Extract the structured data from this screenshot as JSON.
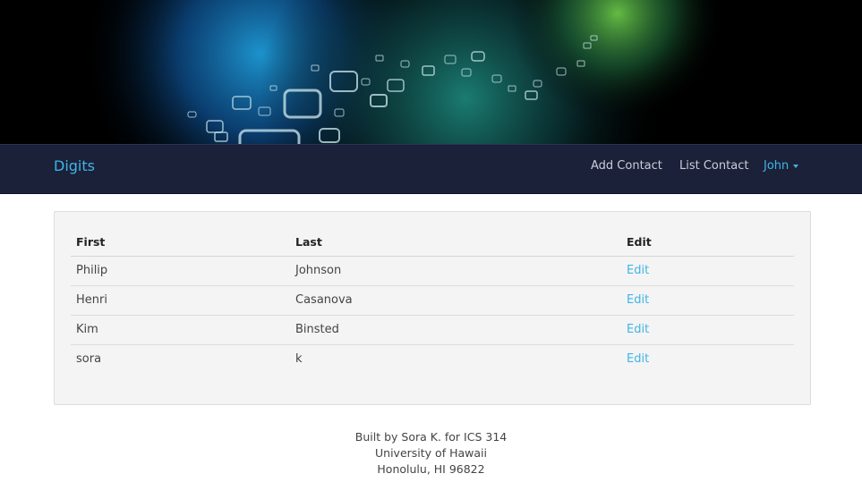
{
  "navbar": {
    "brand": "Digits",
    "links": [
      "Add Contact",
      "List Contact"
    ],
    "user": "John"
  },
  "table": {
    "headers": [
      "First",
      "Last",
      "Edit"
    ],
    "rows": [
      {
        "first": "Philip",
        "last": "Johnson",
        "edit": "Edit"
      },
      {
        "first": "Henri",
        "last": "Casanova",
        "edit": "Edit"
      },
      {
        "first": "Kim",
        "last": "Binsted",
        "edit": "Edit"
      },
      {
        "first": "sora",
        "last": "k",
        "edit": "Edit"
      }
    ]
  },
  "footer": {
    "line1": "Built by Sora K. for ICS 314",
    "line2": "University of Hawaii",
    "line3": "Honolulu, HI 96822"
  },
  "colors": {
    "accent": "#3fb5e6",
    "navbar_bg": "#1b2139",
    "panel_bg": "#f4f4f4"
  }
}
